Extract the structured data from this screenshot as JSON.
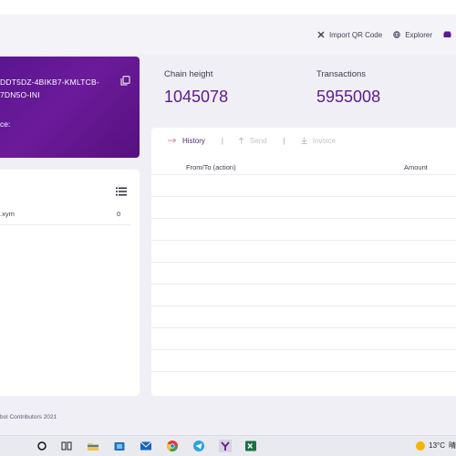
{
  "topnav": {
    "items": [
      {
        "label": "Import QR Code",
        "icon": "qr-code-icon"
      },
      {
        "label": "Explorer",
        "icon": "globe-icon"
      }
    ]
  },
  "account": {
    "address_line1": "DDT5DZ-4BIKB7-KMLTCB-",
    "address_line2": "7DN5O-INI",
    "balance_label": "ce:"
  },
  "mosaics": {
    "rows": [
      {
        "name": ".xym",
        "amount": "0"
      }
    ]
  },
  "stats": {
    "chain_height_label": "Chain height",
    "chain_height_value": "1045078",
    "transactions_label": "Transactions",
    "transactions_value": "5955008"
  },
  "tabs": {
    "history": "History",
    "sep": "|",
    "send": "Send",
    "invoice": "Invoice"
  },
  "table": {
    "col_from": "From/To (action)",
    "col_amount": "Amount"
  },
  "footer": {
    "text": "bol Contributors 2021"
  },
  "taskbar": {
    "temperature": "13°C",
    "tray_text": "晴"
  },
  "colors": {
    "accent": "#5b1a8e",
    "card_gradient_start": "#5a1590",
    "card_gradient_end": "#57107f"
  }
}
